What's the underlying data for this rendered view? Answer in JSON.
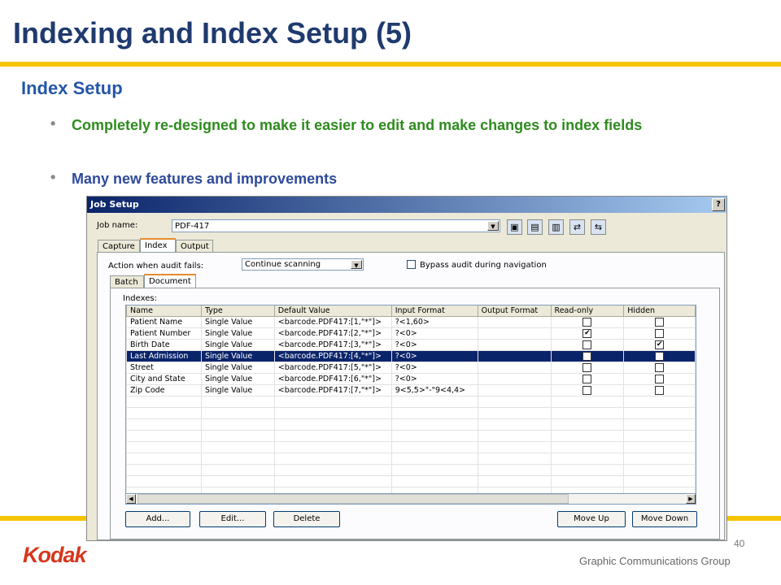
{
  "slide": {
    "title": "Indexing and Index Setup (5)",
    "subtitle": "Index Setup",
    "bullets": [
      "Completely re-designed to make it easier to edit and make changes to index fields",
      "Many new features and improvements"
    ],
    "page_number": "40",
    "footer": "Graphic Communications Group",
    "logo": "Kodak",
    "colors": {
      "title": "#1f3a6e",
      "subtitle": "#2456a8",
      "bullet1": "#2e8b1e",
      "bullet2": "#2e4a9a",
      "rule": "#f5c400",
      "logo": "#d6361c"
    }
  },
  "dialog": {
    "title": "Job Setup",
    "help": "?",
    "job_name_label": "Job name:",
    "job_name_value": "PDF-417",
    "toolbar_icons": [
      "save-icon",
      "save-as-icon",
      "delete-icon",
      "import-icon",
      "export-icon"
    ],
    "top_tabs": [
      "Capture",
      "Index",
      "Output"
    ],
    "active_top_tab": "Index",
    "audit_label": "Action when audit fails:",
    "audit_value": "Continue scanning",
    "bypass_label": "Bypass audit during navigation",
    "sub_tabs": [
      "Batch",
      "Document"
    ],
    "active_sub_tab": "Document",
    "indexes_label": "Indexes:",
    "columns": [
      "Name",
      "Type",
      "Default Value",
      "Input Format",
      "Output Format",
      "Read-only",
      "Hidden"
    ],
    "rows": [
      {
        "name": "Patient Name",
        "type": "Single Value",
        "default": "<barcode.PDF417:[1,\"*\"]>",
        "input": "?<1,60>",
        "output": "",
        "readonly": false,
        "hidden": false
      },
      {
        "name": "Patient Number",
        "type": "Single Value",
        "default": "<barcode.PDF417:[2,\"*\"]>",
        "input": "?<0>",
        "output": "",
        "readonly": true,
        "hidden": false
      },
      {
        "name": "Birth Date",
        "type": "Single Value",
        "default": "<barcode.PDF417:[3,\"*\"]>",
        "input": "?<0>",
        "output": "",
        "readonly": false,
        "hidden": true
      },
      {
        "name": "Last Admission",
        "type": "Single Value",
        "default": "<barcode.PDF417:[4,\"*\"]>",
        "input": "?<0>",
        "output": "",
        "readonly": false,
        "hidden": false,
        "selected": true
      },
      {
        "name": "Street",
        "type": "Single Value",
        "default": "<barcode.PDF417:[5,\"*\"]>",
        "input": "?<0>",
        "output": "",
        "readonly": false,
        "hidden": false
      },
      {
        "name": "City and State",
        "type": "Single Value",
        "default": "<barcode.PDF417:[6,\"*\"]>",
        "input": "?<0>",
        "output": "",
        "readonly": false,
        "hidden": false
      },
      {
        "name": "Zip Code",
        "type": "Single Value",
        "default": "<barcode.PDF417:[7,\"*\"]>",
        "input": "9<5,5>\"-\"9<4,4>",
        "output": "",
        "readonly": false,
        "hidden": false
      }
    ],
    "buttons": {
      "add": "Add...",
      "edit": "Edit...",
      "delete": "Delete",
      "move_up": "Move Up",
      "move_down": "Move Down"
    },
    "check_mark": "✔"
  }
}
